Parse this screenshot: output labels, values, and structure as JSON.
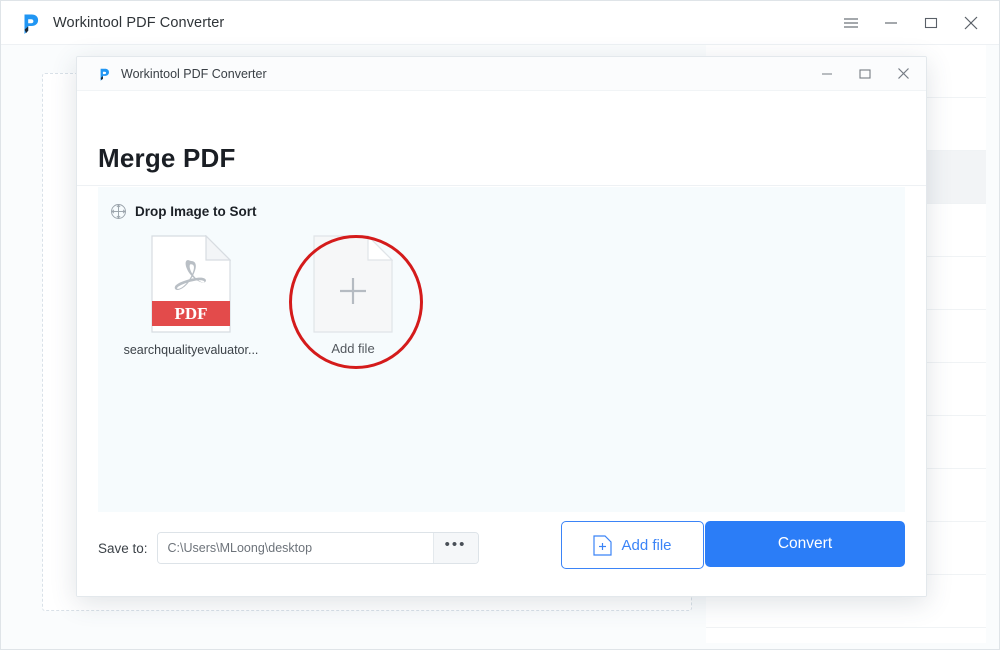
{
  "main_window": {
    "title": "Workintool PDF Converter",
    "logo_icon": "workintool-p-logo",
    "controls": [
      {
        "name": "menu-button",
        "icon": "hamburger-icon"
      },
      {
        "name": "minimize-button",
        "icon": "minimize-icon"
      },
      {
        "name": "maximize-button",
        "icon": "maximize-icon"
      },
      {
        "name": "close-button",
        "icon": "close-icon"
      }
    ]
  },
  "background": {
    "dropzone_name": "background-dropzone",
    "right_panel_rows": [
      {
        "icon": "chevron-down-icon"
      },
      {
        "icon": "chevron-up-icon"
      },
      {
        "icon": ""
      },
      {
        "icon": ""
      },
      {
        "icon": ""
      },
      {
        "icon": ""
      },
      {
        "icon": ""
      },
      {
        "icon": ""
      },
      {
        "icon": ""
      },
      {
        "icon": ""
      },
      {
        "icon": ""
      }
    ]
  },
  "dialog": {
    "titlebar": {
      "title": "Workintool PDF Converter",
      "logo_icon": "workintool-p-logo",
      "minimize_icon": "minimize-icon",
      "maximize_icon": "maximize-icon",
      "close_icon": "close-icon"
    },
    "page_title": "Merge PDF",
    "sort_hint": {
      "icon": "move-crosshair-icon",
      "text": "Drop Image to Sort"
    },
    "files": [
      {
        "name": "searchqualityevaluator...",
        "badge": "PDF",
        "thumb_icon": "pdf-file-icon"
      }
    ],
    "add_tile": {
      "label": "Add file",
      "icon": "plus-document-icon",
      "highlight": {
        "shape": "circle",
        "color": "#d41b1b"
      }
    },
    "footer": {
      "save_to_label": "Save to:",
      "save_to_value": "C:\\Users\\MLoong\\desktop",
      "save_to_placeholder": "C:\\Users\\MLoong\\desktop",
      "browse_label": "•••",
      "add_file_button": {
        "label": "Add file",
        "icon": "document-plus-icon"
      },
      "convert_button": {
        "label": "Convert"
      }
    }
  },
  "colors": {
    "accent_blue": "#2b7df7",
    "highlight_red": "#d41b1b",
    "pdf_badge_red": "#e34b4b",
    "panel_bg": "#f6fbfd"
  }
}
